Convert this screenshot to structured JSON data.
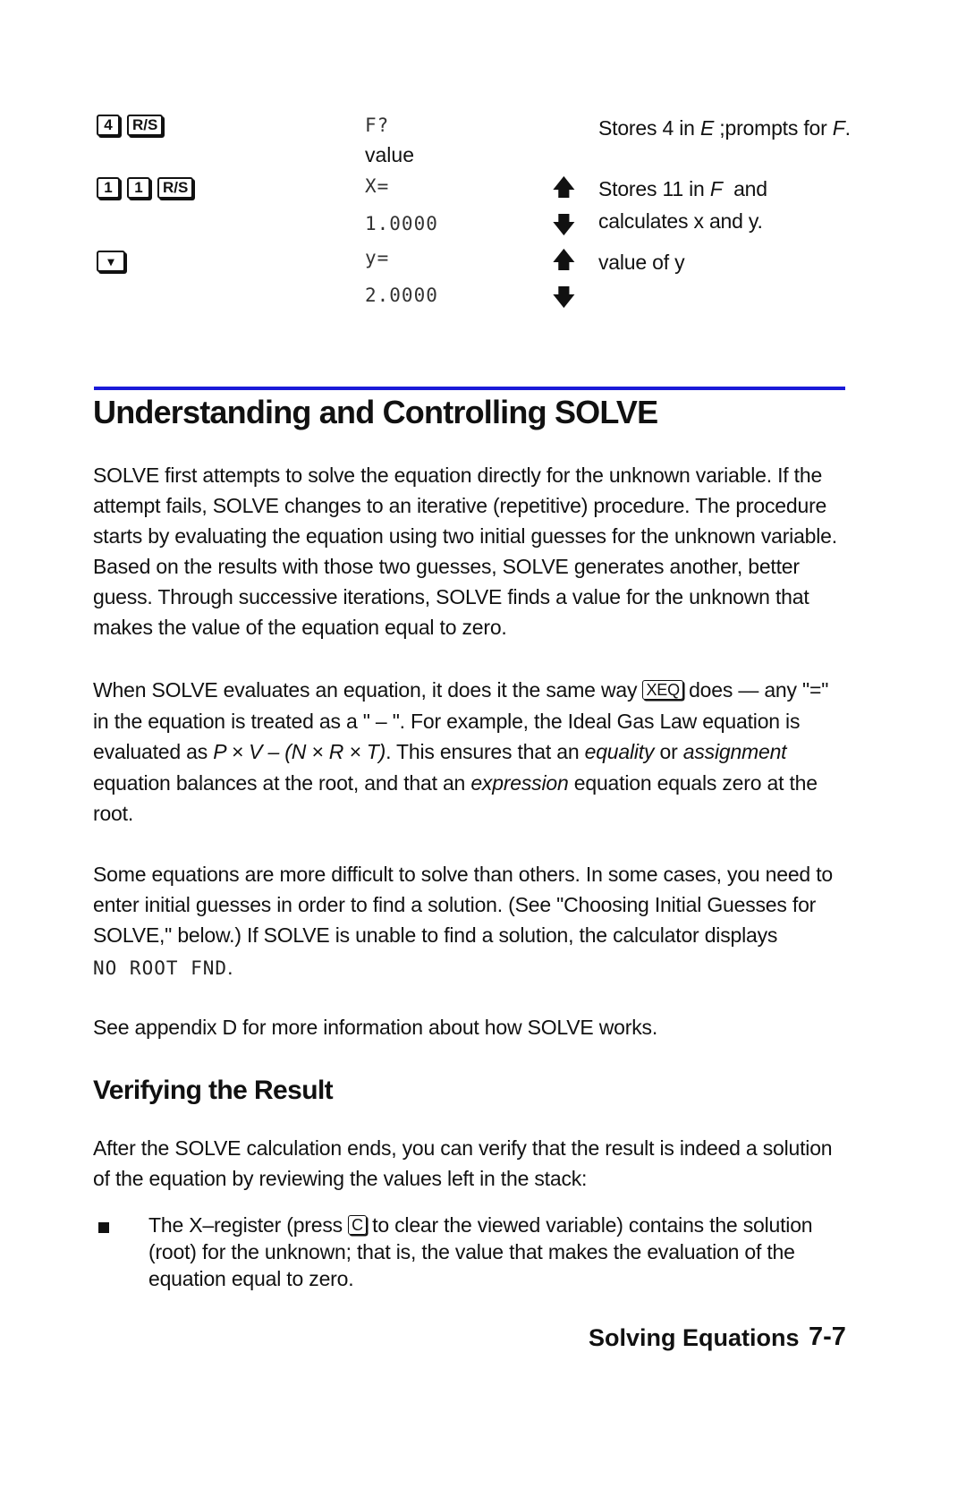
{
  "keystroke_table": {
    "rows": [
      {
        "keys": [
          "4",
          "R/S"
        ],
        "display": [
          "F?",
          "value"
        ],
        "arrows": [],
        "description": [
          "Stores 4 in ",
          "E",
          " ;prompts for ",
          "F",
          "."
        ]
      },
      {
        "keys": [
          "1",
          "1",
          "R/S"
        ],
        "display": [
          "X=",
          "1.0000"
        ],
        "arrows": [
          "up-arrow",
          "down-arrow"
        ],
        "description_lines": [
          "Stores 11 in F  and",
          "calculates x and y."
        ],
        "description_parts": {
          "pre": "Stores 11 in ",
          "var": "F",
          "post": "  and",
          "line2": "calculates x and y."
        }
      },
      {
        "keys": [
          "▾"
        ],
        "display": [
          "y=",
          "2.0000"
        ],
        "arrows": [
          "up-arrow",
          "down-arrow"
        ],
        "description": "value of y"
      }
    ]
  },
  "section": {
    "title": "Understanding and Controlling SOLVE",
    "paragraphs": {
      "p1": "SOLVE first attempts to solve the equation directly for the unknown variable. If the attempt fails, SOLVE changes to an iterative (repetitive) procedure. The procedure starts by evaluating the equation using two initial guesses for the unknown variable. Based on the results with those two guesses, SOLVE generates another, better guess. Through successive iterations, SOLVE finds a value for the unknown that makes the value of the equation equal to zero.",
      "p2": {
        "a": "When SOLVE evaluates an equation, it does it the same way ",
        "key": "XEQ",
        "b": " does — any \"=\" in the equation is treated as a \" – \". For example, the Ideal Gas Law equation is evaluated as ",
        "formula": "P × V – (N × R × T)",
        "c": ". This ensures that an ",
        "em1": "equality",
        "d": " or ",
        "em2": "assignment",
        "e": " equation balances at the root, and that an ",
        "em3": "expression",
        "f": " equation equals zero at the root."
      },
      "p3": "Some equations are more difficult to solve than others. In some cases, you need to enter initial guesses in order to find a solution. (See \"Choosing Initial Guesses for SOLVE,\" below.) If SOLVE is unable to find a solution, the calculator displays",
      "p3_display": "NO ROOT FND",
      "p3_end": ".",
      "p4": "See appendix D for more information about how SOLVE works."
    }
  },
  "subsection": {
    "title": "Verifying the Result",
    "intro": "After the SOLVE calculation ends, you can verify that the result is indeed a solution of the equation by reviewing the values left in the stack:",
    "bullet": {
      "a": "The X–register (press ",
      "key": "C",
      "b": " to clear the viewed variable) contains the solution (root) for the unknown; that is, the value that makes the evaluation of the equation equal to zero."
    }
  },
  "footer": {
    "chapter": "Solving Equations",
    "page": "7-7"
  }
}
